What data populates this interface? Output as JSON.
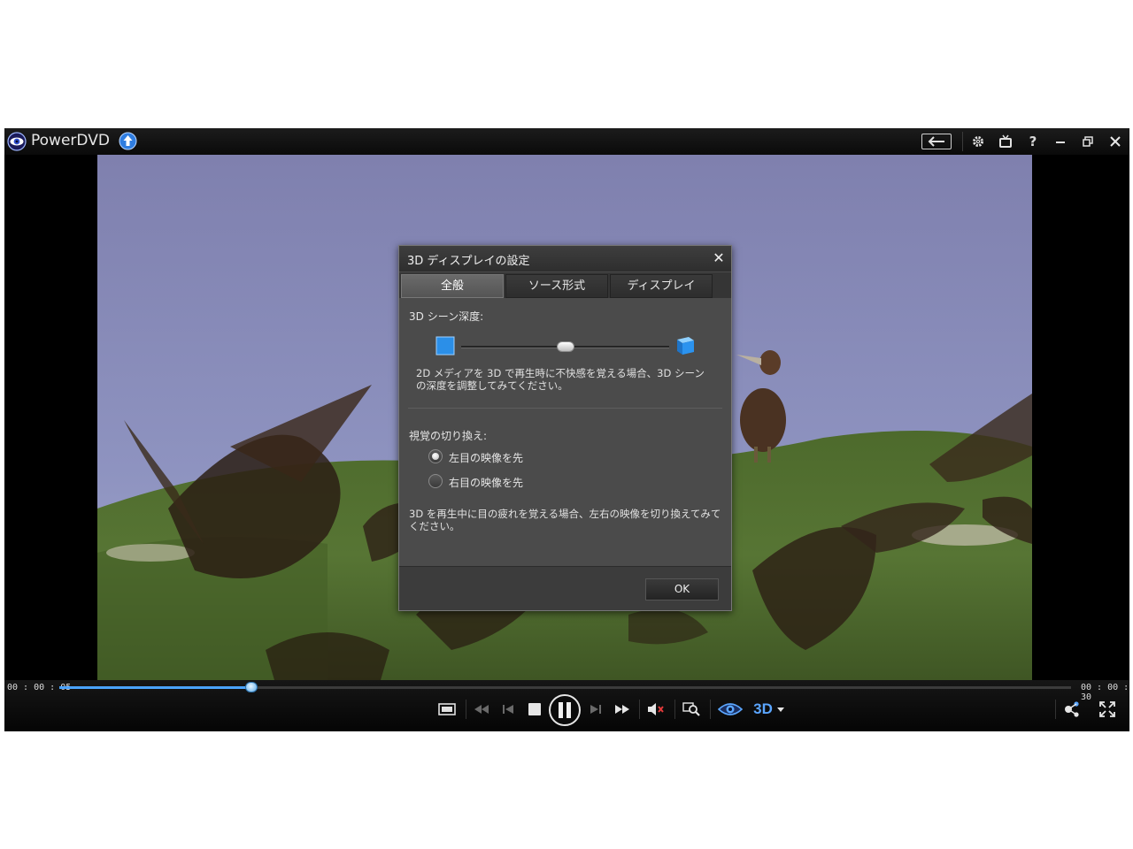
{
  "app": {
    "title": "PowerDVD"
  },
  "dialog": {
    "title": "3D ディスプレイの設定",
    "tabs": [
      {
        "label": "全般",
        "active": true
      },
      {
        "label": "ソース形式",
        "active": false
      },
      {
        "label": "ディスプレイ",
        "active": false
      }
    ],
    "depth": {
      "label": "3D シーン深度:",
      "level_fraction": 0.5,
      "description_line1": "2D メディアを 3D で再生時に不快感を覚える場合、3D シーン",
      "description_line2": "の深度を調整してみてください。"
    },
    "view_switch": {
      "label": "視覚の切り換え:",
      "options": [
        {
          "label": "左目の映像を先",
          "checked": true
        },
        {
          "label": "右目の映像を先",
          "checked": false
        }
      ],
      "description_line1": "3D を再生中に目の疲れを覚える場合、左右の映像を切り換えてみて",
      "description_line2": "ください。"
    },
    "ok_label": "OK"
  },
  "playback": {
    "current_time": "00 : 00 : 05",
    "total_time": "00 : 00 : 30",
    "progress_fraction": 0.19,
    "threed_label": "3D"
  },
  "colors": {
    "accent": "#4aa3ff",
    "sky": "#8d8fb8",
    "grass": "#4f6b2e"
  },
  "icons": {
    "title_bar": [
      "back-arrow-icon",
      "gear-icon",
      "tv-icon",
      "help-icon",
      "minimize-icon",
      "restore-icon",
      "close-icon"
    ],
    "controls": [
      "aspect-ratio-icon",
      "rewind-icon",
      "previous-icon",
      "stop-icon",
      "pause-icon",
      "next-icon",
      "fast-forward-icon",
      "mute-icon",
      "zoom-icon",
      "eye-icon",
      "3d-dropdown-icon",
      "share-icon",
      "fullscreen-icon"
    ]
  }
}
